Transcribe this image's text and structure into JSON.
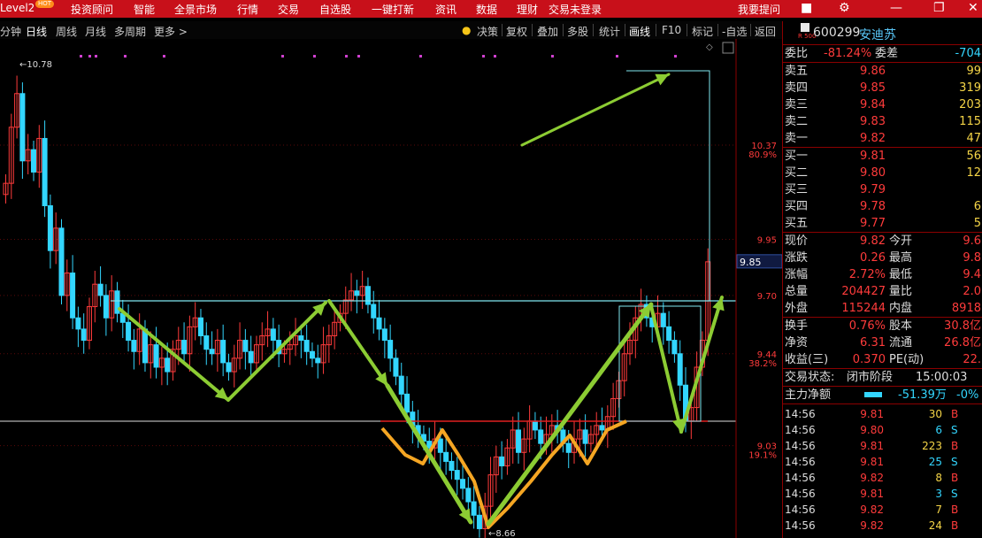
{
  "topbar": {
    "level": "Level2",
    "hot": "HOT",
    "menu": [
      "投资顾问",
      "智能",
      "全景市场",
      "行情",
      "交易",
      "自选股",
      "一键打新",
      "资讯",
      "数据",
      "理财"
    ],
    "login": "交易未登录",
    "ask": "我要提问"
  },
  "toolbar": {
    "periods": [
      "分钟",
      "日线",
      "周线",
      "月线",
      "多周期",
      "更多 >"
    ],
    "active": "日线",
    "tools": [
      "决策",
      "复权",
      "叠加",
      "多股",
      "统计",
      "画线",
      "F10",
      "标记",
      "-自选",
      "返回"
    ],
    "decision_icon": "lightbulb-icon"
  },
  "chart": {
    "high_label": "10.78",
    "low_label": "8.66",
    "price_tag": "9.85",
    "price_ticks": [
      {
        "price": "10.37",
        "pct": "80.9%"
      },
      {
        "price": "9.95",
        "pct": ""
      },
      {
        "price": "9.70",
        "pct": ""
      },
      {
        "price": "9.44",
        "pct": "38.2%"
      },
      {
        "price": "9.03",
        "pct": "19.1%"
      }
    ],
    "colors": {
      "up": "#ff3b3b",
      "down": "#33d6ff",
      "cyan_line": "#7fe7ef",
      "red_line": "#e02020",
      "green_arrow": "#8ccc33",
      "orange": "#f5a623",
      "marker": "#d040d0"
    }
  },
  "quote": {
    "code": "600299",
    "name": "安迪苏",
    "badge": "R 500",
    "ratio_label": "委比",
    "ratio": "-81.24%",
    "diff_label": "委差",
    "diff": "-704",
    "asks": [
      {
        "label": "卖五",
        "price": "9.86",
        "vol": "99"
      },
      {
        "label": "卖四",
        "price": "9.85",
        "vol": "319"
      },
      {
        "label": "卖三",
        "price": "9.84",
        "vol": "203"
      },
      {
        "label": "卖二",
        "price": "9.83",
        "vol": "115"
      },
      {
        "label": "卖一",
        "price": "9.82",
        "vol": "47"
      }
    ],
    "bids": [
      {
        "label": "买一",
        "price": "9.81",
        "vol": "56"
      },
      {
        "label": "买二",
        "price": "9.80",
        "vol": "12"
      },
      {
        "label": "买三",
        "price": "9.79",
        "vol": ""
      },
      {
        "label": "买四",
        "price": "9.78",
        "vol": "6"
      },
      {
        "label": "买五",
        "price": "9.77",
        "vol": "5"
      }
    ],
    "stats": [
      {
        "l1": "现价",
        "v1": "9.82",
        "l2": "今开",
        "v2": "9.6"
      },
      {
        "l1": "涨跌",
        "v1": "0.26",
        "l2": "最高",
        "v2": "9.8"
      },
      {
        "l1": "涨幅",
        "v1": "2.72%",
        "l2": "最低",
        "v2": "9.4"
      },
      {
        "l1": "总量",
        "v1": "204427",
        "l2": "量比",
        "v2": "2.0"
      },
      {
        "l1": "外盘",
        "v1": "115244",
        "l2": "内盘",
        "v2": "8918"
      }
    ],
    "stats2": [
      {
        "l1": "换手",
        "v1": "0.76%",
        "l2": "股本",
        "v2": "30.8亿"
      },
      {
        "l1": "净资",
        "v1": "6.31",
        "l2": "流通",
        "v2": "26.8亿"
      },
      {
        "l1": "收益(三)",
        "v1": "0.370",
        "l2": "PE(动)",
        "v2": "22."
      }
    ],
    "status_label": "交易状态:",
    "status": "闭市阶段",
    "status_time": "15:00:03",
    "flow_label": "主力净额",
    "flow_value": "-51.39万",
    "flow_pct": "-0%"
  },
  "ticks": [
    {
      "time": "14:56",
      "price": "9.81",
      "vol": "30",
      "side": "B"
    },
    {
      "time": "14:56",
      "price": "9.80",
      "vol": "6",
      "side": "S"
    },
    {
      "time": "14:56",
      "price": "9.81",
      "vol": "223",
      "side": "B"
    },
    {
      "time": "14:56",
      "price": "9.81",
      "vol": "25",
      "side": "S"
    },
    {
      "time": "14:56",
      "price": "9.82",
      "vol": "8",
      "side": "B"
    },
    {
      "time": "14:56",
      "price": "9.81",
      "vol": "3",
      "side": "S"
    },
    {
      "time": "14:56",
      "price": "9.82",
      "vol": "7",
      "side": "B"
    },
    {
      "time": "14:56",
      "price": "9.82",
      "vol": "24",
      "side": "B"
    }
  ]
}
